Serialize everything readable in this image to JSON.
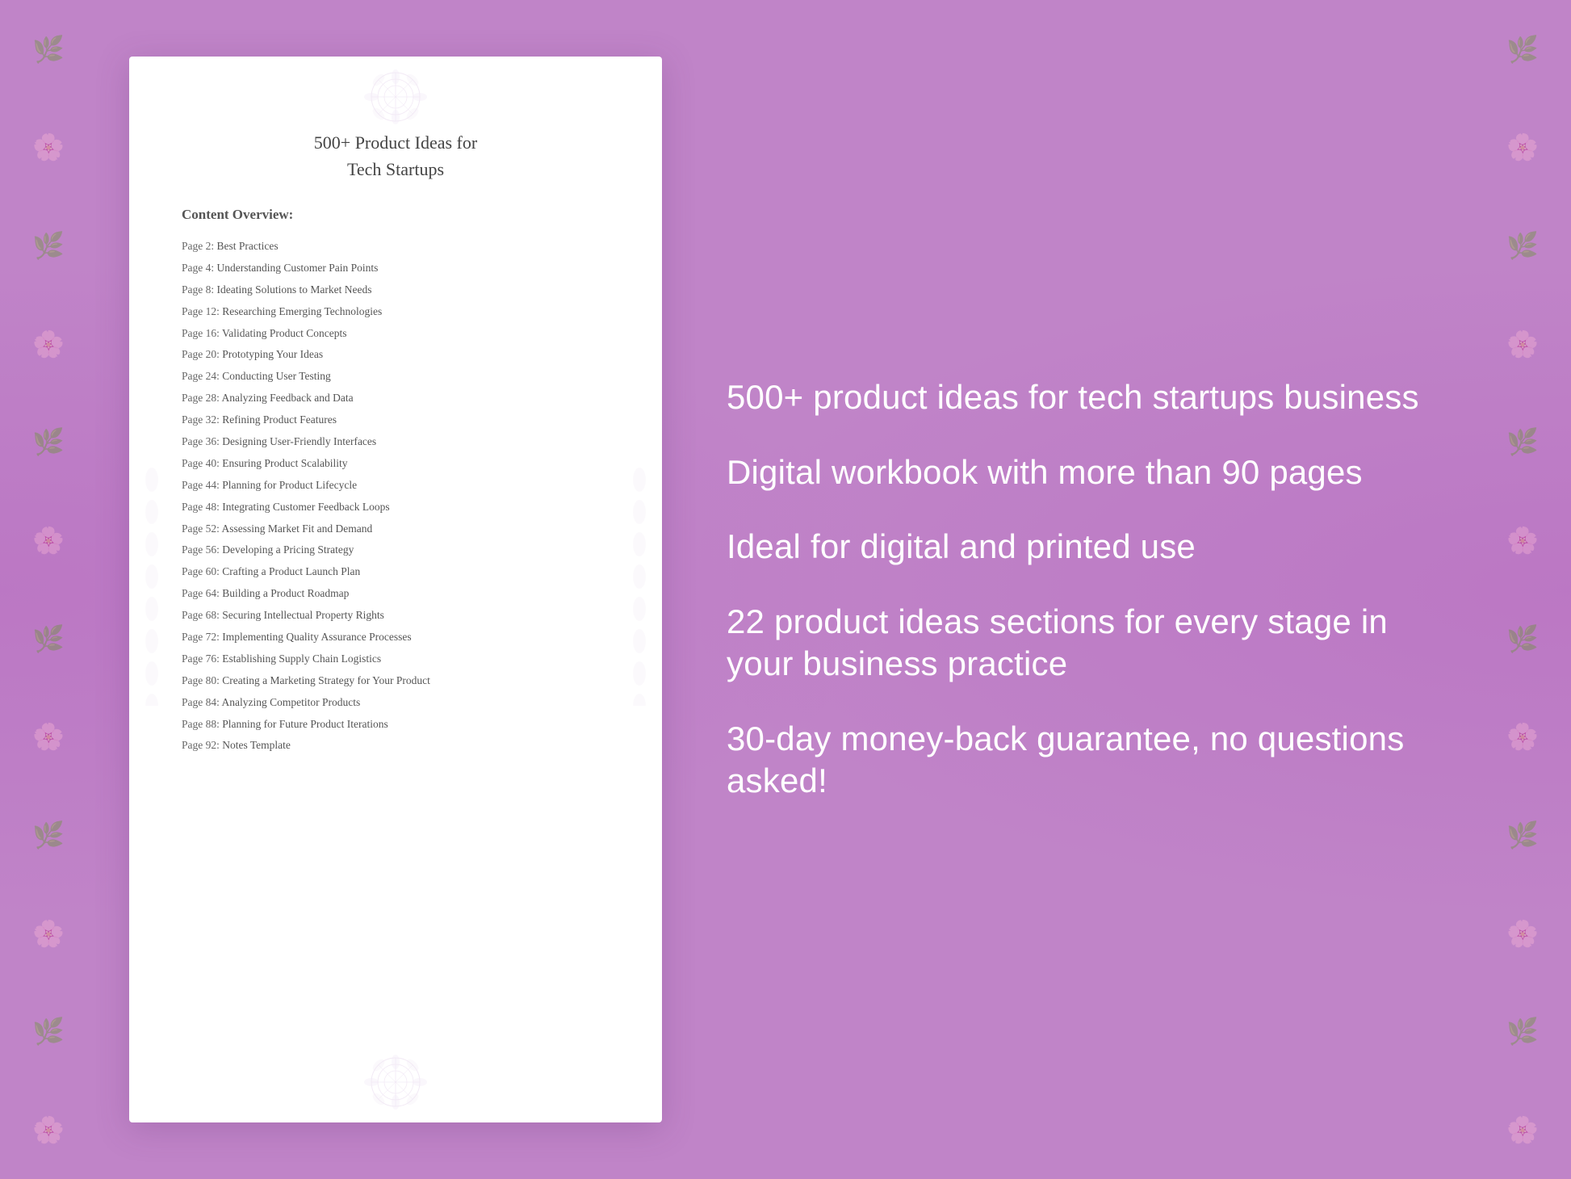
{
  "page": {
    "background_color": "#c084c8"
  },
  "document": {
    "title_line1": "500+ Product Ideas for",
    "title_line2": "Tech Startups",
    "content_label": "Content Overview:",
    "toc_items": [
      {
        "page": "Page  2:",
        "title": "Best Practices"
      },
      {
        "page": "Page  4:",
        "title": "Understanding Customer Pain Points"
      },
      {
        "page": "Page  8:",
        "title": "Ideating Solutions to Market Needs"
      },
      {
        "page": "Page 12:",
        "title": "Researching Emerging Technologies"
      },
      {
        "page": "Page 16:",
        "title": "Validating Product Concepts"
      },
      {
        "page": "Page 20:",
        "title": "Prototyping Your Ideas"
      },
      {
        "page": "Page 24:",
        "title": "Conducting User Testing"
      },
      {
        "page": "Page 28:",
        "title": "Analyzing Feedback and Data"
      },
      {
        "page": "Page 32:",
        "title": "Refining Product Features"
      },
      {
        "page": "Page 36:",
        "title": "Designing User-Friendly Interfaces"
      },
      {
        "page": "Page 40:",
        "title": "Ensuring Product Scalability"
      },
      {
        "page": "Page 44:",
        "title": "Planning for Product Lifecycle"
      },
      {
        "page": "Page 48:",
        "title": "Integrating Customer Feedback Loops"
      },
      {
        "page": "Page 52:",
        "title": "Assessing Market Fit and Demand"
      },
      {
        "page": "Page 56:",
        "title": "Developing a Pricing Strategy"
      },
      {
        "page": "Page 60:",
        "title": "Crafting a Product Launch Plan"
      },
      {
        "page": "Page 64:",
        "title": "Building a Product Roadmap"
      },
      {
        "page": "Page 68:",
        "title": "Securing Intellectual Property Rights"
      },
      {
        "page": "Page 72:",
        "title": "Implementing Quality Assurance Processes"
      },
      {
        "page": "Page 76:",
        "title": "Establishing Supply Chain Logistics"
      },
      {
        "page": "Page 80:",
        "title": "Creating a Marketing Strategy for Your Product"
      },
      {
        "page": "Page 84:",
        "title": "Analyzing Competitor Products"
      },
      {
        "page": "Page 88:",
        "title": "Planning for Future Product Iterations"
      },
      {
        "page": "Page 92:",
        "title": "Notes Template"
      }
    ]
  },
  "features": [
    "500+ product ideas for tech startups business",
    "Digital workbook with more than 90 pages",
    "Ideal for digital and printed use",
    "22 product ideas sections for every stage in your business practice",
    "30-day money-back guarantee, no questions asked!"
  ],
  "floral_symbol": "✿",
  "icons": {
    "mandala": "❀"
  }
}
